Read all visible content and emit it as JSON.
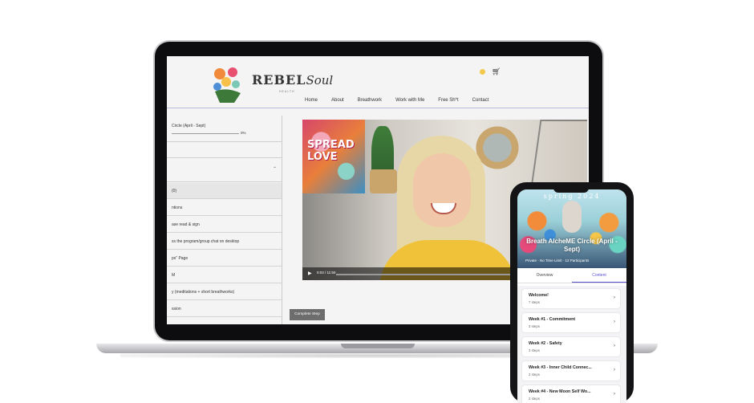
{
  "site": {
    "logo_main": "REBEL",
    "logo_script": "Soul",
    "logo_sub": "HEALTH",
    "nav": [
      "Home",
      "About",
      "Breathwork",
      "Work with Me",
      "Free Sh*t",
      "Contact"
    ],
    "cart_icon": "cart-icon"
  },
  "sidebar": {
    "program_title": "Circle (April - Sept)",
    "progress_pct": "0%",
    "progress_value": 0,
    "items": [
      "(0)",
      "ntions",
      "ase read & sign",
      "ss the program/group chat on desktop",
      "ps\" Page",
      "M",
      "y (meditations + short breathworks)",
      "ssion"
    ]
  },
  "video": {
    "wall_art_text": "SPREAD LOVE",
    "time": "0:03 / 11:50"
  },
  "complete_button": "Complete Step",
  "phone": {
    "season": "spring 2024",
    "title": "Breath AlcheME Circle (April - Sept)",
    "meta": "Private · No Time Limit · 12 Participants",
    "tabs": [
      {
        "label": "Overview",
        "active": false
      },
      {
        "label": "Content",
        "active": true
      }
    ],
    "cards": [
      {
        "title": "Welcome!",
        "sub": "7 steps"
      },
      {
        "title": "Week #1 - Commitment",
        "sub": "3 steps"
      },
      {
        "title": "Week #2 - Safety",
        "sub": "3 steps"
      },
      {
        "title": "Week #3 - Inner Child Connec...",
        "sub": "2 steps"
      },
      {
        "title": "Week #4 - New Moon Self Wo...",
        "sub": "2 steps"
      }
    ]
  },
  "colors": {
    "accent": "#5a4fcf",
    "button": "#6d6d6d",
    "sun": "#f2c94c"
  }
}
